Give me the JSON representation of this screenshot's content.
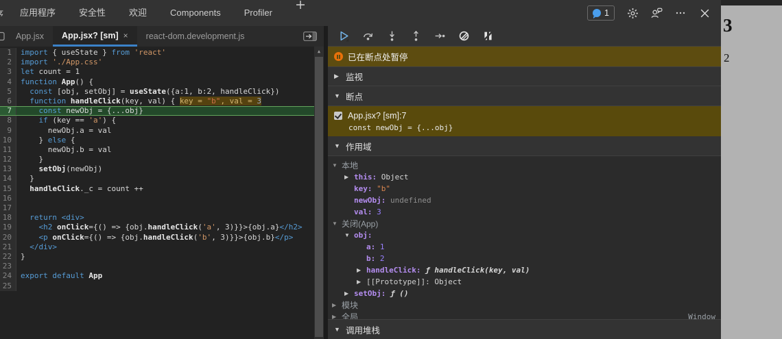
{
  "colors": {
    "accent_blue": "#3b82c9",
    "paused_olive": "#5d4c10",
    "breakpoint_olive": "#594a0c",
    "current_line_green": "#23492a",
    "keyword_blue": "#569cd6",
    "string_orange": "#d29766",
    "number_purple": "#9980ff",
    "property_purple": "#b48df0",
    "page_bg_gray": "#b2b2b2"
  },
  "topbar": {
    "partial_tab": "序",
    "tabs": [
      "应用程序",
      "安全性",
      "欢迎",
      "Components",
      "Profiler"
    ],
    "plus_label": "+",
    "issues_count": "1",
    "icons": [
      "issues-bubble-icon",
      "gear-icon",
      "feedback-icon",
      "more-options-icon",
      "close-icon"
    ]
  },
  "file_tabs": [
    {
      "label": "App.jsx",
      "active": false
    },
    {
      "label": "App.jsx? [sm]",
      "active": true,
      "close": "×"
    },
    {
      "label": "react-dom.development.js",
      "active": false
    }
  ],
  "editor": {
    "lines": [
      {
        "n": 1,
        "segs": [
          [
            "kw",
            "import"
          ],
          [
            "code",
            " { useState } "
          ],
          [
            "kw",
            "from"
          ],
          [
            "code",
            " "
          ],
          [
            "str",
            "'react'"
          ]
        ]
      },
      {
        "n": 2,
        "segs": [
          [
            "kw",
            "import"
          ],
          [
            "code",
            " "
          ],
          [
            "str",
            "'./App.css'"
          ]
        ]
      },
      {
        "n": 3,
        "segs": [
          [
            "kw",
            "let"
          ],
          [
            "code",
            " count = 1"
          ]
        ]
      },
      {
        "n": 4,
        "segs": [
          [
            "kw",
            "function"
          ],
          [
            "code",
            " "
          ],
          [
            "fn",
            "App"
          ],
          [
            "code",
            "() {"
          ]
        ]
      },
      {
        "n": 5,
        "segs": [
          [
            "code",
            "  "
          ],
          [
            "kw",
            "const"
          ],
          [
            "code",
            " [obj, setObj] = "
          ],
          [
            "fn",
            "useState"
          ],
          [
            "code",
            "({a:1, b:2, handleClick})"
          ]
        ]
      },
      {
        "n": 6,
        "segs": [
          [
            "code",
            "  "
          ],
          [
            "kw",
            "function"
          ],
          [
            "code",
            " "
          ],
          [
            "fn",
            "handleClick"
          ],
          [
            "code",
            "(key, val) { "
          ],
          [
            "ann",
            "key = "
          ],
          [
            "annstr",
            "\"b\""
          ],
          [
            "ann",
            ", val = "
          ],
          [
            "annnum",
            "3"
          ]
        ]
      },
      {
        "n": 7,
        "current": true,
        "segs": [
          [
            "code",
            "    "
          ],
          [
            "kw",
            "const"
          ],
          [
            "code",
            " newObj = {...obj}"
          ]
        ]
      },
      {
        "n": 8,
        "segs": [
          [
            "code",
            "    "
          ],
          [
            "kw",
            "if"
          ],
          [
            "code",
            " (key == "
          ],
          [
            "str",
            "'a'"
          ],
          [
            "code",
            ") {"
          ]
        ]
      },
      {
        "n": 9,
        "segs": [
          [
            "code",
            "      newObj.a = val"
          ]
        ]
      },
      {
        "n": 10,
        "segs": [
          [
            "code",
            "    } "
          ],
          [
            "kw",
            "else"
          ],
          [
            "code",
            " {"
          ]
        ]
      },
      {
        "n": 11,
        "segs": [
          [
            "code",
            "      newObj.b = val"
          ]
        ]
      },
      {
        "n": 12,
        "segs": [
          [
            "code",
            "    }"
          ]
        ]
      },
      {
        "n": 13,
        "segs": [
          [
            "code",
            "    "
          ],
          [
            "fn",
            "setObj"
          ],
          [
            "code",
            "(newObj)"
          ]
        ]
      },
      {
        "n": 14,
        "segs": [
          [
            "code",
            "  }"
          ]
        ]
      },
      {
        "n": 15,
        "segs": [
          [
            "code",
            "  "
          ],
          [
            "fn",
            "handleClick"
          ],
          [
            "code",
            "._c = count ++"
          ]
        ]
      },
      {
        "n": 16,
        "segs": []
      },
      {
        "n": 17,
        "segs": []
      },
      {
        "n": 18,
        "segs": [
          [
            "code",
            "  "
          ],
          [
            "kw",
            "return"
          ],
          [
            "code",
            " "
          ],
          [
            "kw",
            "<div>"
          ]
        ]
      },
      {
        "n": 19,
        "segs": [
          [
            "code",
            "    "
          ],
          [
            "kw",
            "<h2"
          ],
          [
            "code",
            " "
          ],
          [
            "fn",
            "onClick"
          ],
          [
            "code",
            "={() => {obj."
          ],
          [
            "fn",
            "handleClick"
          ],
          [
            "code",
            "("
          ],
          [
            "str",
            "'a'"
          ],
          [
            "code",
            ", 3)}}>{obj.a}"
          ],
          [
            "kw",
            "</h2>"
          ]
        ]
      },
      {
        "n": 20,
        "segs": [
          [
            "code",
            "    "
          ],
          [
            "kw",
            "<p"
          ],
          [
            "code",
            " "
          ],
          [
            "fn",
            "onClick"
          ],
          [
            "code",
            "={() => {obj."
          ],
          [
            "fn",
            "handleClick"
          ],
          [
            "code",
            "("
          ],
          [
            "str",
            "'b'"
          ],
          [
            "code",
            ", 3)}}>{obj.b}"
          ],
          [
            "kw",
            "</p>"
          ]
        ]
      },
      {
        "n": 21,
        "segs": [
          [
            "code",
            "  "
          ],
          [
            "kw",
            "</div>"
          ]
        ]
      },
      {
        "n": 22,
        "segs": [
          [
            "code",
            "}"
          ]
        ]
      },
      {
        "n": 23,
        "segs": []
      },
      {
        "n": 24,
        "segs": [
          [
            "kw",
            "export"
          ],
          [
            "code",
            " "
          ],
          [
            "kw",
            "default"
          ],
          [
            "code",
            " "
          ],
          [
            "fn",
            "App"
          ]
        ]
      },
      {
        "n": 25,
        "segs": []
      }
    ]
  },
  "sidebar": {
    "toolbar_icons": [
      "resume-icon",
      "step-over-icon",
      "step-into-icon",
      "step-out-icon",
      "step-icon",
      "deactivate-breakpoints-icon",
      "pause-on-exceptions-icon"
    ],
    "paused_banner": "已在断点处暂停",
    "watch_label": "监视",
    "breakpoints_label": "断点",
    "breakpoint_entry": {
      "checked": true,
      "location": "App.jsx? [sm]:7",
      "code": "const newObj = {...obj}"
    },
    "scope_label": "作用域",
    "scope_rows": [
      {
        "kind": "group",
        "id": "local",
        "indent": 0,
        "arrow": "▼",
        "label": "本地"
      },
      {
        "kind": "prop",
        "indent": 1,
        "arrow": "▶",
        "name": "this",
        "value": "Object",
        "vtype": "obj"
      },
      {
        "kind": "prop",
        "indent": 1,
        "name": "key",
        "value": "\"b\"",
        "vtype": "str"
      },
      {
        "kind": "prop",
        "indent": 1,
        "name": "newObj",
        "value": "undefined",
        "vtype": "undef"
      },
      {
        "kind": "prop",
        "indent": 1,
        "name": "val",
        "value": "3",
        "vtype": "num"
      },
      {
        "kind": "group",
        "id": "closure",
        "indent": 0,
        "arrow": "▼",
        "label": "关闭(App)"
      },
      {
        "kind": "prop",
        "indent": 1,
        "arrow": "▼",
        "name": "obj",
        "value": "",
        "vtype": "obj"
      },
      {
        "kind": "prop",
        "indent": 2,
        "name": "a",
        "value": "1",
        "vtype": "num"
      },
      {
        "kind": "prop",
        "indent": 2,
        "name": "b",
        "value": "2",
        "vtype": "num"
      },
      {
        "kind": "prop",
        "indent": 2,
        "arrow": "▶",
        "name": "handleClick",
        "value": "ƒ handleClick(key, val)",
        "vtype": "fn"
      },
      {
        "kind": "prop",
        "indent": 2,
        "arrow": "▶",
        "name": "[[Prototype]]",
        "value": "Object",
        "vtype": "obj",
        "special": true
      },
      {
        "kind": "prop",
        "indent": 1,
        "arrow": "▶",
        "name": "setObj",
        "value": "ƒ ()",
        "vtype": "fn"
      },
      {
        "kind": "group",
        "id": "module",
        "indent": 0,
        "arrow": "▶",
        "label": "模块"
      },
      {
        "kind": "group",
        "id": "global",
        "indent": 0,
        "arrow": "▶",
        "label": "全局",
        "right": "Window"
      }
    ],
    "callstack_label": "调用堆栈"
  },
  "page_preview": {
    "h2_text": "3",
    "p_text": "2"
  }
}
